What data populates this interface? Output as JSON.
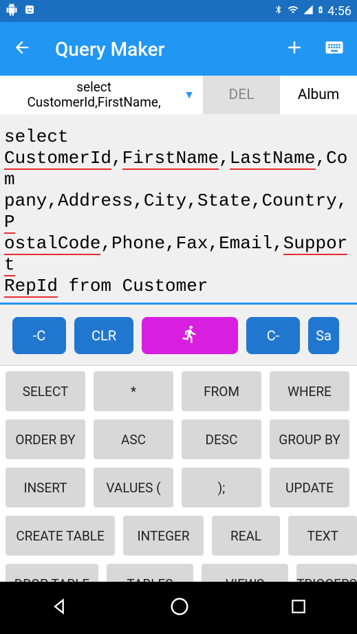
{
  "status": {
    "time": "4:56"
  },
  "appbar": {
    "title": "Query Maker"
  },
  "tabs": {
    "select_line1": "select",
    "select_line2": "CustomerId,FirstName,",
    "del": "DEL",
    "album": "Album"
  },
  "query": {
    "segments": [
      {
        "text": "select ",
        "u": false,
        "br": true
      },
      {
        "text": "CustomerId",
        "u": true
      },
      {
        "text": ",",
        "u": false
      },
      {
        "text": "FirstName",
        "u": true
      },
      {
        "text": ",",
        "u": false
      },
      {
        "text": "LastName",
        "u": true
      },
      {
        "text": ",Com",
        "u": false,
        "br": true
      },
      {
        "text": "pany,Address,City,State,Country,",
        "u": false
      },
      {
        "text": "P",
        "u": true,
        "br": true
      },
      {
        "text": "ostalCode",
        "u": true
      },
      {
        "text": ",Phone,Fax,Email,",
        "u": false
      },
      {
        "text": "Support",
        "u": true,
        "br": true
      },
      {
        "text": "RepId",
        "u": true
      },
      {
        "text": " from Customer",
        "u": false
      }
    ]
  },
  "actions": {
    "minus_c": "-C",
    "clr": "CLR",
    "c_minus": "C-",
    "save": "Sa"
  },
  "keywords": {
    "row1": [
      "SELECT",
      "*",
      "FROM",
      "WHERE"
    ],
    "row2": [
      "ORDER BY",
      "ASC",
      "DESC",
      "GROUP BY"
    ],
    "row3": [
      "INSERT",
      "VALUES (",
      ");",
      "UPDATE"
    ],
    "row4": [
      "CREATE TABLE",
      "INTEGER",
      "REAL",
      "TEXT"
    ],
    "row5": [
      "DROP TABLE",
      "TABLES",
      "VIEWS",
      "TRIGGERS"
    ]
  }
}
